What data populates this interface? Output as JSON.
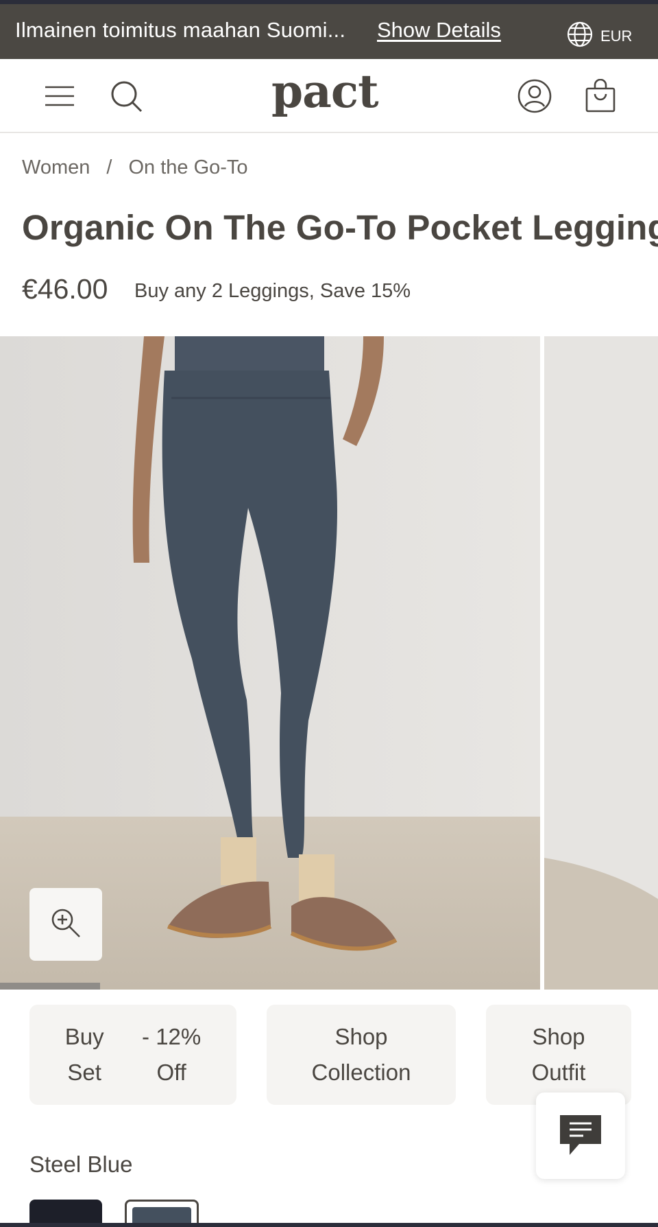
{
  "promo_bar": {
    "text": "Ilmainen toimitus maahan Suomi...",
    "link": "Show Details",
    "currency": "EUR"
  },
  "header": {
    "logo": "pact",
    "icons": [
      "menu-icon",
      "search-icon",
      "account-icon",
      "bag-icon"
    ]
  },
  "breadcrumb": {
    "items": [
      "Women",
      "On the Go-To"
    ],
    "separator": "/"
  },
  "product": {
    "title": "Organic On The Go-To Pocket Legging",
    "price": "€46.00",
    "promo": "Buy any 2 Leggings, Save 15%"
  },
  "gallery": {
    "zoom_icon": "zoom-in-icon",
    "progress": 0.15
  },
  "actions": {
    "buy_set": [
      "Buy",
      "Set"
    ],
    "discount": [
      "- 12%",
      "Off"
    ],
    "shop_collection": [
      "Shop",
      "Collection"
    ],
    "shop_outfit": [
      "Shop",
      "Outfit"
    ]
  },
  "chat": {
    "icon": "chat-icon"
  },
  "color": {
    "selected": "Steel Blue",
    "swatches": [
      "#1d1f29",
      "#44505e"
    ]
  },
  "colors": {
    "promo_bg": "#4b4843",
    "text": "#4a4641",
    "chip_bg": "#f5f4f2"
  }
}
